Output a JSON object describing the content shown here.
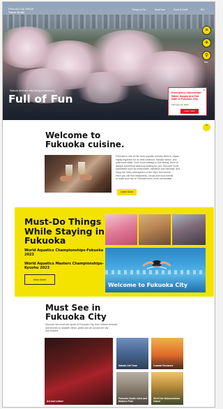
{
  "hero": {
    "logo_line1": "Fukuoka City Official",
    "logo_line2": "Travel Guide",
    "nav": [
      "Things to Do",
      "Must See",
      "Food & Drink",
      "EN"
    ],
    "side_icons": [
      {
        "name": "info-icon",
        "glyph": "≡",
        "label": ""
      },
      {
        "name": "transport-icon",
        "glyph": "✈",
        "label": ""
      },
      {
        "name": "bicycle-icon",
        "glyph": "⚲",
        "label": "Bike"
      }
    ],
    "subtitle": "Nature and the city living in harmony",
    "title": "Full of Fun",
    "alert": {
      "text": "Emergency Information: Water Supply and Hot Bath in Fukuoka City",
      "date": "February 22, 2023",
      "close": "×",
      "button": "Learn more"
    }
  },
  "scroll_top_glyph": "⌃",
  "cuisine": {
    "title": "Welcome to Fukuoka cuisine.",
    "body": [
      "Fukuoka is one of the most popular culinary cities in Japan,",
      "highly regarded for its fresh seafood, Hakata ramen, and",
      "yatai food stalls. From local izakaya to fine dining, there is",
      "always something delicious waiting for you. Discover local",
      "specialties such as motsunabe, mentaiko and mizutaki, and",
      "enjoy the lively atmosphere of the city's food scene.",
      "Here you will find restaurants, shops and food events",
      "to make your trip to Fukuoka even more memorable."
    ],
    "button": "Learn More"
  },
  "mustdo": {
    "title": "Must-Do Things While Staying in Fukuoka",
    "items": [
      "World Aquatics Championships-Fukuoka 2023",
      "World Aquatics Masters Championships-Kyushu 2023"
    ],
    "button": "View More",
    "banner_text": "Welcome to Fukuoka City"
  },
  "mustsee": {
    "title": "Must See in Fukuoka City",
    "body": [
      "Discover the must-see spots of Fukuoka City, from historic temples",
      "and shrines to seaside views, parks and art across the city",
      "and beyond."
    ],
    "cards": [
      {
        "label": "Art and culture"
      },
      {
        "label": "Hakata Old Town"
      },
      {
        "label": "Coastal Romance"
      },
      {
        "label": "Fukuoka Castle ruins and Maizuru Park"
      },
      {
        "label": "Stroll the Nokonoshima Island"
      }
    ]
  },
  "colors": {
    "accent_yellow": "#f4e300",
    "alert_red": "#e3152b"
  }
}
